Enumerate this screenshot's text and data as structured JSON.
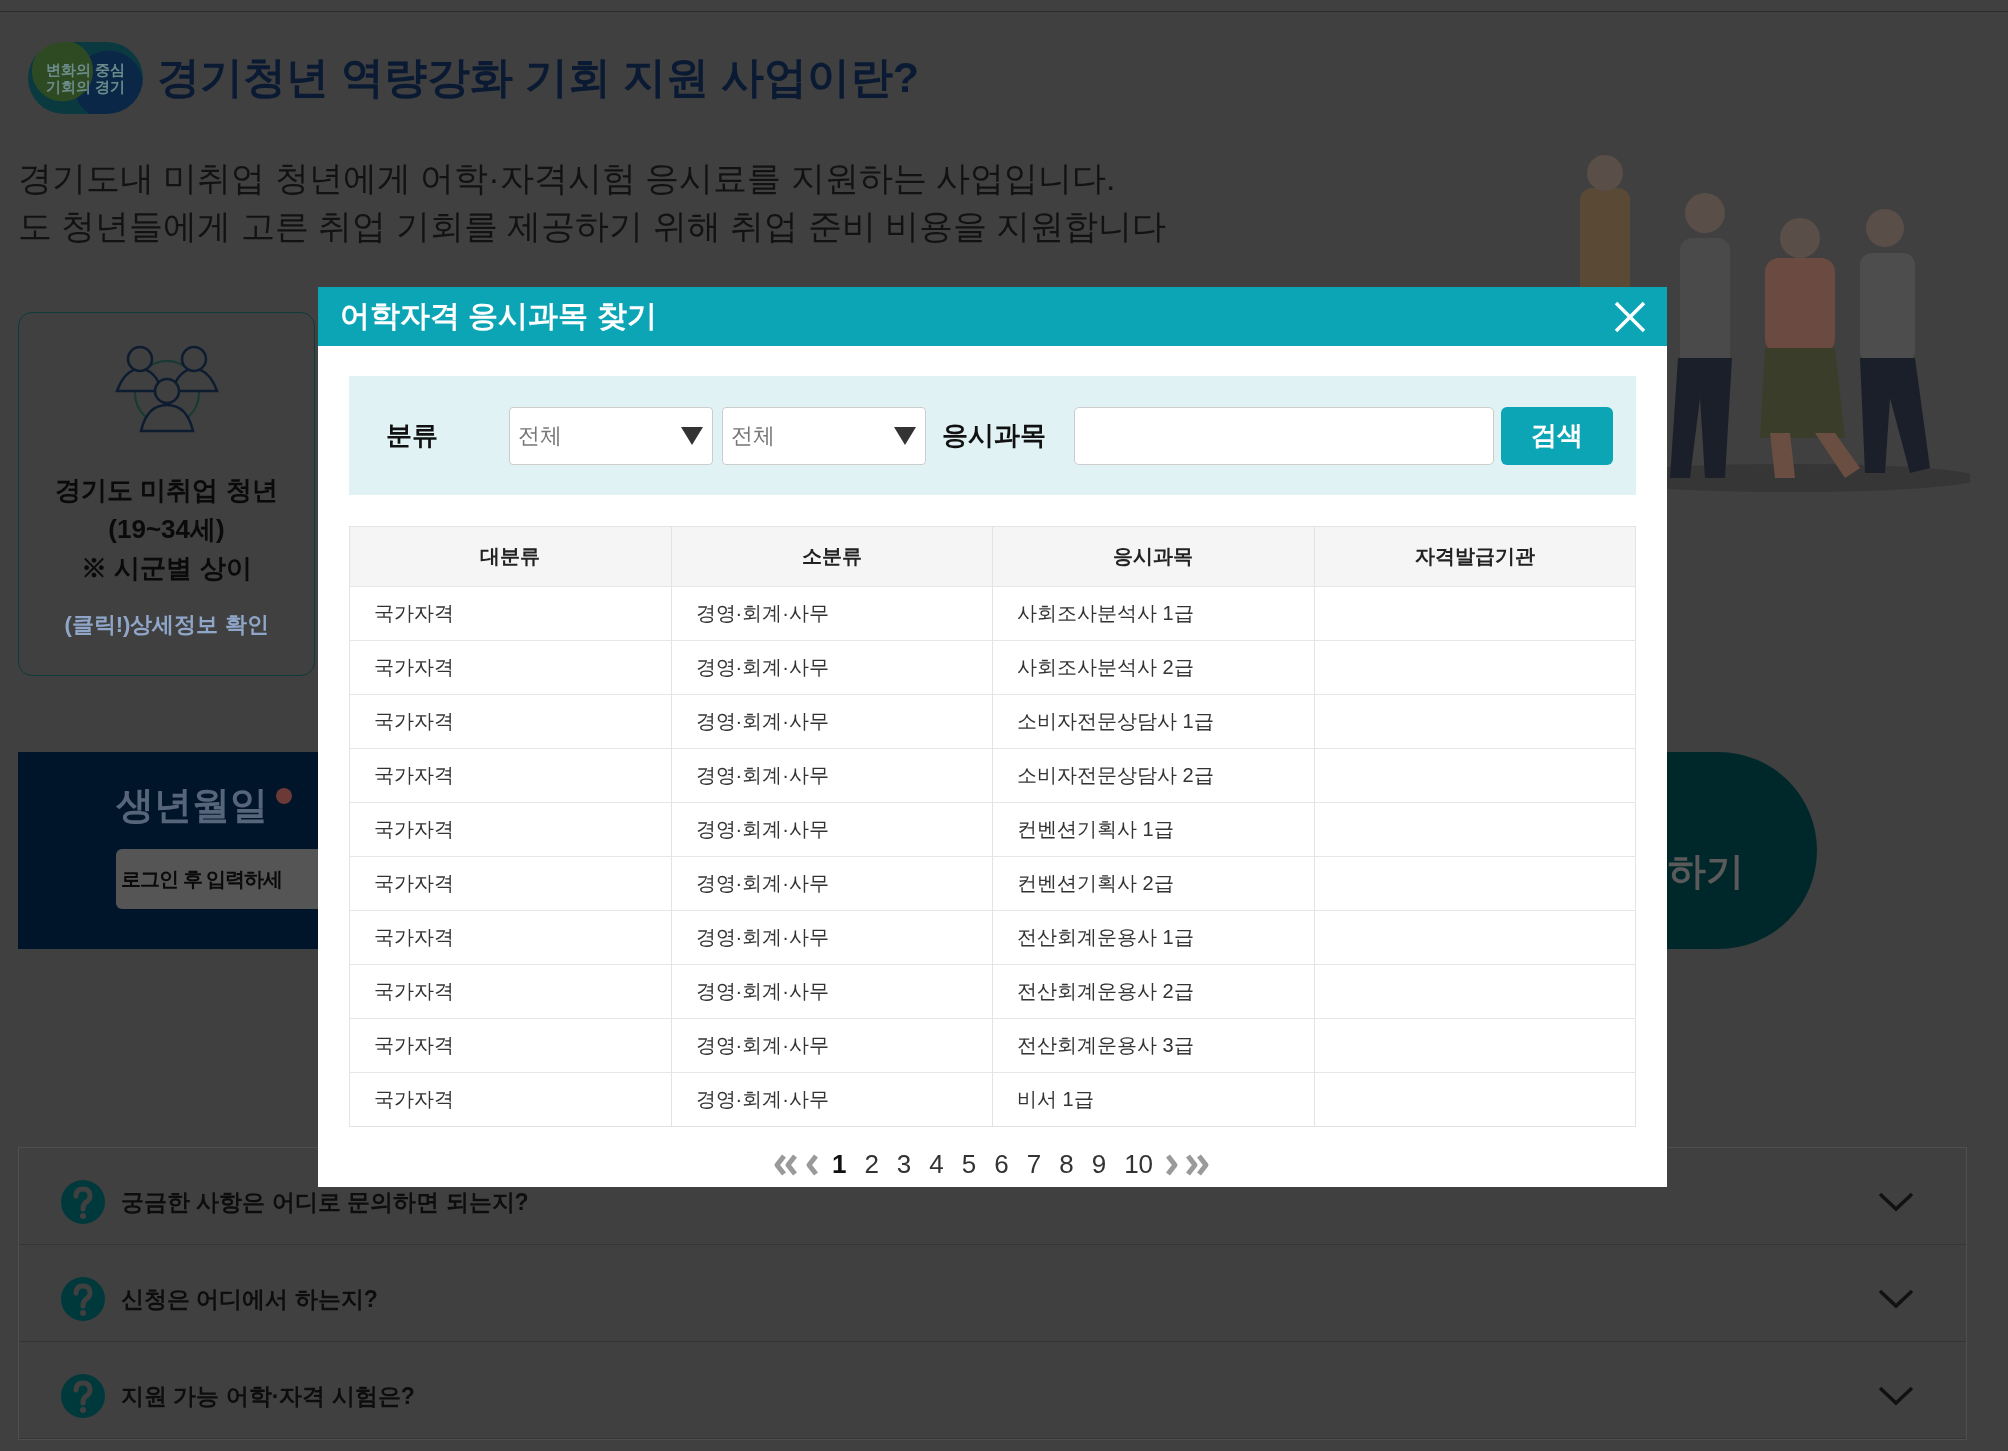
{
  "logo": {
    "lines": [
      "변화의 중심",
      "기회의 경기"
    ]
  },
  "page_title": "경기청년 역량강화 기회 지원 사업이란?",
  "description": [
    "경기도내 미취업 청년에게 어학·자격시험 응시료를 지원하는 사업입니다.",
    "도 청년들에게 고른 취업 기회를 제공하기 위해 취업 준비 비용을 지원합니다"
  ],
  "eligibility_card": {
    "lines": [
      "경기도 미취업 청년",
      "(19~34세)",
      "※ 시군별 상이"
    ],
    "link": "(클릭!)상세정보 확인"
  },
  "birth_date": {
    "label": "생년월일",
    "required": true,
    "placeholder": "로그인 후 입력하세"
  },
  "apply_button": {
    "label": "하기"
  },
  "faq": [
    {
      "question": "궁금한 사항은 어디로 문의하면 되는지?",
      "expanded": false
    },
    {
      "question": "신청은 어디에서 하는지?",
      "expanded": false
    },
    {
      "question": "지원 가능 어학·자격 시험은?",
      "expanded": false
    }
  ],
  "modal": {
    "title": "어학자격 응시과목 찾기",
    "filter": {
      "label": "분류",
      "selects": [
        {
          "value": "전체"
        },
        {
          "value": "전체"
        }
      ],
      "subject_label": "응시과목",
      "search_button": "검색"
    },
    "table": {
      "columns": [
        "대분류",
        "소분류",
        "응시과목",
        "자격발급기관"
      ],
      "rows": [
        {
          "major": "국가자격",
          "minor": "경영·회계·사무",
          "subject": "사회조사분석사 1급"
        },
        {
          "major": "국가자격",
          "minor": "경영·회계·사무",
          "subject": "사회조사분석사 2급"
        },
        {
          "major": "국가자격",
          "minor": "경영·회계·사무",
          "subject": "소비자전문상담사 1급"
        },
        {
          "major": "국가자격",
          "minor": "경영·회계·사무",
          "subject": "소비자전문상담사 2급"
        },
        {
          "major": "국가자격",
          "minor": "경영·회계·사무",
          "subject": "컨벤션기획사 1급"
        },
        {
          "major": "국가자격",
          "minor": "경영·회계·사무",
          "subject": "컨벤션기획사 2급"
        },
        {
          "major": "국가자격",
          "minor": "경영·회계·사무",
          "subject": "전산회계운용사 1급"
        },
        {
          "major": "국가자격",
          "minor": "경영·회계·사무",
          "subject": "전산회계운용사 2급"
        },
        {
          "major": "국가자격",
          "minor": "경영·회계·사무",
          "subject": "전산회계운용사 3급"
        },
        {
          "major": "국가자격",
          "minor": "경영·회계·사무",
          "subject": "비서 1급"
        }
      ]
    },
    "pagination": [
      {
        "label": "1",
        "selected": true
      },
      {
        "label": "2",
        "selected": false
      },
      {
        "label": "3",
        "selected": false
      },
      {
        "label": "4",
        "selected": false
      },
      {
        "label": "5",
        "selected": false
      },
      {
        "label": "6",
        "selected": false
      },
      {
        "label": "7",
        "selected": false
      },
      {
        "label": "8",
        "selected": false
      },
      {
        "label": "9",
        "selected": false
      },
      {
        "label": "10",
        "selected": false
      }
    ]
  }
}
